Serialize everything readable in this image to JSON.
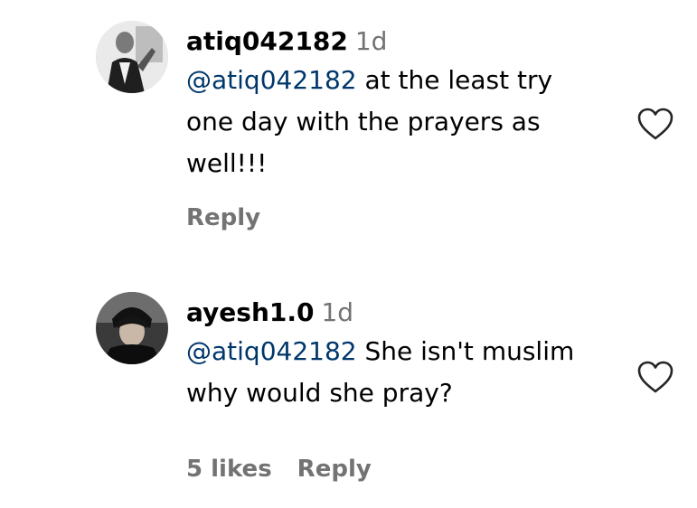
{
  "comments": [
    {
      "username": "atiq042182",
      "time": "1d",
      "mention": "@atiq042182",
      "text_line1_rest": " at the least try",
      "text_line2": "one day with the prayers as",
      "text_line3": "well!!!",
      "reply_label": "Reply"
    },
    {
      "username": "ayesh1.0",
      "time": "1d",
      "mention": "@atiq042182",
      "text_line1_rest": " She isn't muslim",
      "text_line2": "why would she pray?",
      "likes_label": "5 likes",
      "reply_label": "Reply"
    }
  ],
  "icons": {
    "like": "heart-outline-icon"
  },
  "colors": {
    "secondary_text": "#737373",
    "mention": "#00376b",
    "heart_stroke": "#262626"
  }
}
